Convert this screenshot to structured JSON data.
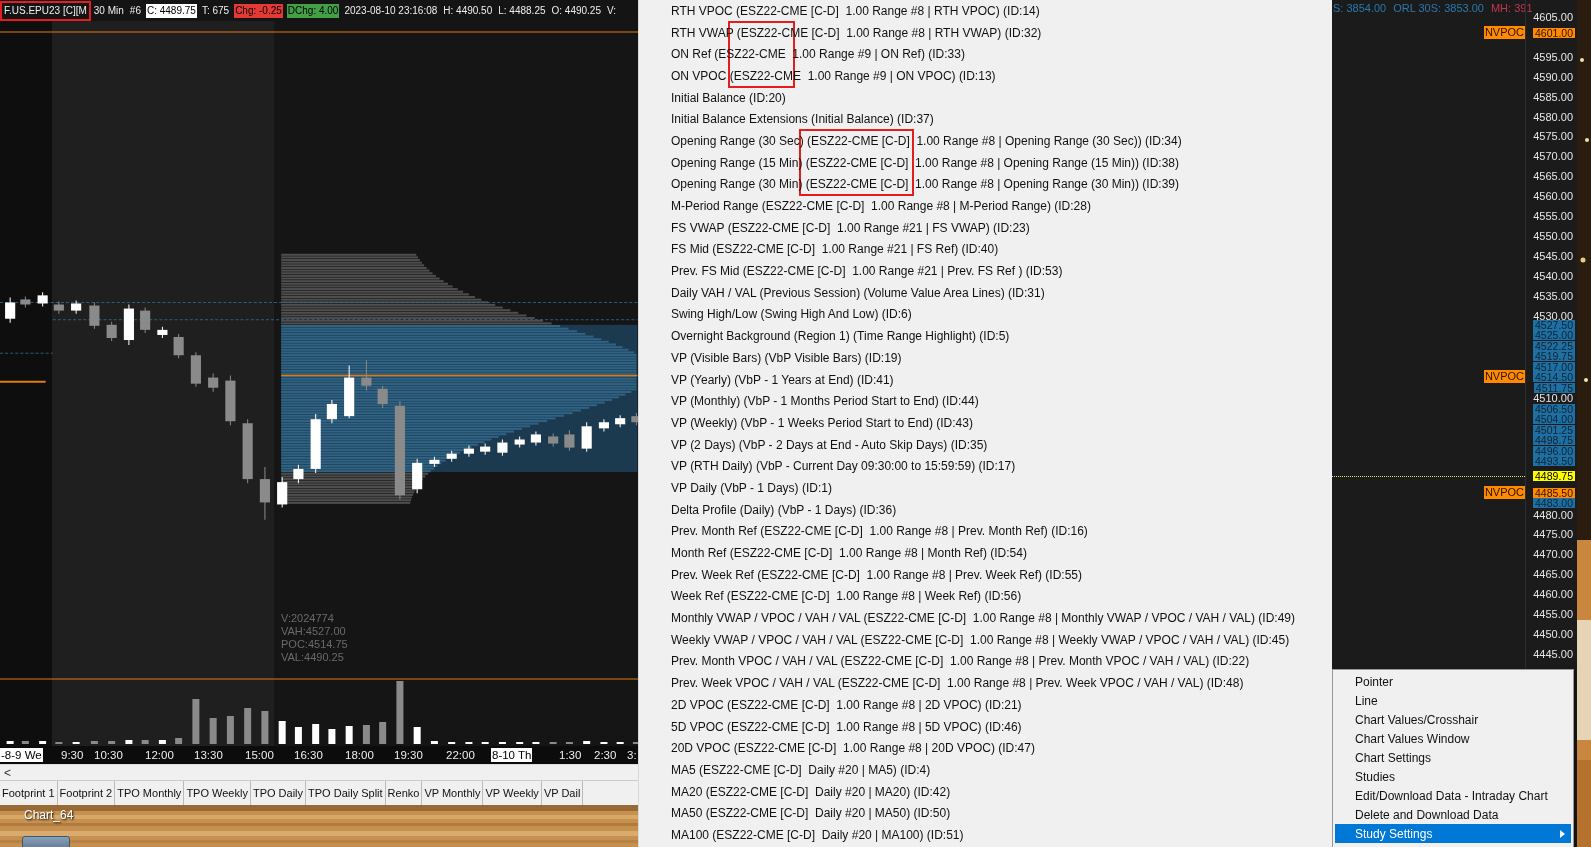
{
  "chart": {
    "header": [
      {
        "text": "F.US.EPU23 [C][M",
        "kind": "symbol",
        "boxed": true
      },
      {
        "text": "30 Min",
        "kind": "plain",
        "boxed": false
      },
      {
        "text": "#6",
        "kind": "plain",
        "boxed": false
      },
      {
        "text": "C: 4489.75",
        "kind": "close",
        "boxed": false
      },
      {
        "text": "T: 675",
        "kind": "plain",
        "boxed": false
      },
      {
        "text": "Chg: -0.25",
        "kind": "down",
        "boxed": false
      },
      {
        "text": "DChg: 4.00",
        "kind": "up",
        "boxed": false
      },
      {
        "text": "2023-08-10 23:16:08",
        "kind": "plain",
        "boxed": false
      },
      {
        "text": "H: 4490.50",
        "kind": "plain",
        "boxed": false
      },
      {
        "text": "L: 4488.25",
        "kind": "plain",
        "boxed": false
      },
      {
        "text": "O: 4490.25",
        "kind": "plain",
        "boxed": false
      },
      {
        "text": "V:",
        "kind": "plain",
        "boxed": false
      }
    ],
    "profile_stats": [
      "V:2024774",
      "VAH:4527.00",
      "POC:4514.75",
      "VAL:4490.25"
    ],
    "time_axis": [
      {
        "text": "-8-9 We",
        "highlighted": true
      },
      {
        "text": "9:30",
        "highlighted": false
      },
      {
        "text": "10:30",
        "highlighted": false
      },
      {
        "text": "12:00",
        "highlighted": false
      },
      {
        "text": "13:30",
        "highlighted": false
      },
      {
        "text": "15:00",
        "highlighted": false
      },
      {
        "text": "16:30",
        "highlighted": false
      },
      {
        "text": "18:00",
        "highlighted": false
      },
      {
        "text": "19:30",
        "highlighted": false
      },
      {
        "text": "22:00",
        "highlighted": false
      },
      {
        "text": "8-10 Th",
        "highlighted": true
      },
      {
        "text": "1:30",
        "highlighted": false
      },
      {
        "text": "2:30",
        "highlighted": false
      },
      {
        "text": "3:",
        "highlighted": false
      }
    ],
    "scroll_left": "<",
    "tabs": [
      {
        "label": "Footprint 1",
        "selected": false
      },
      {
        "label": "Footprint 2",
        "selected": false
      },
      {
        "label": "TPO Monthly",
        "selected": false
      },
      {
        "label": "TPO Weekly",
        "selected": false
      },
      {
        "label": "TPO Daily",
        "selected": false
      },
      {
        "label": "TPO Daily Split",
        "selected": false
      },
      {
        "label": "Renko",
        "selected": false
      },
      {
        "label": "VP Monthly",
        "selected": false
      },
      {
        "label": "VP Weekly",
        "selected": false
      },
      {
        "label": "VP Dail",
        "selected": false
      }
    ]
  },
  "studies": [
    {
      "text": "RTH VPOC (ESZ22-CME [C-D]  1.00 Range #8 | RTH VPOC) (ID:14)",
      "boxed": false
    },
    {
      "text": "RTH VWAP (ESZ22-CME [C-D]  1.00 Range #8 | RTH VWAP) (ID:32)",
      "boxed": true
    },
    {
      "text": "ON Ref (ESZ22-CME  1.00 Range #9 | ON Ref) (ID:33)",
      "boxed": true
    },
    {
      "text": "ON VPOC (ESZ22-CME  1.00 Range #9 | ON VPOC) (ID:13)",
      "boxed": true
    },
    {
      "text": "Initial Balance (ID:20)",
      "boxed": false
    },
    {
      "text": "Initial Balance Extensions (Initial Balance) (ID:37)",
      "boxed": false
    },
    {
      "text": "Opening Range (30 Sec) (ESZ22-CME [C-D]  1.00 Range #8 | Opening Range (30 Sec)) (ID:34)",
      "boxed": true
    },
    {
      "text": "Opening Range (15 Min) (ESZ22-CME [C-D]  1.00 Range #8 | Opening Range (15 Min)) (ID:38)",
      "boxed": true
    },
    {
      "text": "Opening Range (30 Min) (ESZ22-CME [C-D]  1.00 Range #8 | Opening Range (30 Min)) (ID:39)",
      "boxed": true
    },
    {
      "text": "M-Period Range (ESZ22-CME [C-D]  1.00 Range #8 | M-Period Range) (ID:28)",
      "boxed": false
    },
    {
      "text": "FS VWAP (ESZ22-CME [C-D]  1.00 Range #21 | FS VWAP) (ID:23)",
      "boxed": false
    },
    {
      "text": "FS Mid (ESZ22-CME [C-D]  1.00 Range #21 | FS Ref) (ID:40)",
      "boxed": false
    },
    {
      "text": "Prev. FS Mid (ESZ22-CME [C-D]  1.00 Range #21 | Prev. FS Ref ) (ID:53)",
      "boxed": false
    },
    {
      "text": "Daily VAH / VAL (Previous Session) (Volume Value Area Lines) (ID:31)",
      "boxed": false
    },
    {
      "text": "Swing High/Low (Swing High And Low) (ID:6)",
      "boxed": false
    },
    {
      "text": "Overnight Background (Region 1) (Time Range Highlight) (ID:5)",
      "boxed": false
    },
    {
      "text": "VP (Visible Bars) (VbP Visible Bars) (ID:19)",
      "boxed": false
    },
    {
      "text": "VP (Yearly) (VbP - 1 Years at End) (ID:41)",
      "boxed": false
    },
    {
      "text": "VP (Monthly) (VbP - 1 Months Period Start to End) (ID:44)",
      "boxed": false
    },
    {
      "text": "VP (Weekly) (VbP - 1 Weeks Period Start to End) (ID:43)",
      "boxed": false
    },
    {
      "text": "VP (2 Days) (VbP - 2 Days at End - Auto Skip Days) (ID:35)",
      "boxed": false
    },
    {
      "text": "VP (RTH Daily) (VbP - Current Day 09:30:00 to 15:59:59) (ID:17)",
      "boxed": false
    },
    {
      "text": "VP Daily (VbP - 1 Days) (ID:1)",
      "boxed": false
    },
    {
      "text": "Delta Profile (Daily) (VbP - 1 Days) (ID:36)",
      "boxed": false
    },
    {
      "text": "Prev. Month Ref (ESZ22-CME [C-D]  1.00 Range #8 | Prev. Month Ref) (ID:16)",
      "boxed": false
    },
    {
      "text": "Month Ref (ESZ22-CME [C-D]  1.00 Range #8 | Month Ref) (ID:54)",
      "boxed": false
    },
    {
      "text": "Prev. Week Ref (ESZ22-CME [C-D]  1.00 Range #8 | Prev. Week Ref) (ID:55)",
      "boxed": false
    },
    {
      "text": "Week Ref (ESZ22-CME [C-D]  1.00 Range #8 | Week Ref) (ID:56)",
      "boxed": false
    },
    {
      "text": "Monthly VWAP / VPOC / VAH / VAL (ESZ22-CME [C-D]  1.00 Range #8 | Monthly VWAP / VPOC / VAH / VAL) (ID:49)",
      "boxed": false
    },
    {
      "text": "Weekly VWAP / VPOC / VAH / VAL (ESZ22-CME [C-D]  1.00 Range #8 | Weekly VWAP / VPOC / VAH / VAL) (ID:45)",
      "boxed": false
    },
    {
      "text": "Prev. Month VPOC / VAH / VAL (ESZ22-CME [C-D]  1.00 Range #8 | Prev. Month VPOC / VAH / VAL) (ID:22)",
      "boxed": false
    },
    {
      "text": "Prev. Week VPOC / VAH / VAL (ESZ22-CME [C-D]  1.00 Range #8 | Prev. Week VPOC / VAH / VAL) (ID:48)",
      "boxed": false
    },
    {
      "text": "2D VPOC (ESZ22-CME [C-D]  1.00 Range #8 | 2D VPOC) (ID:21)",
      "boxed": false
    },
    {
      "text": "5D VPOC (ESZ22-CME [C-D]  1.00 Range #8 | 5D VPOC) (ID:46)",
      "boxed": false
    },
    {
      "text": "20D VPOC (ESZ22-CME [C-D]  1.00 Range #8 | 20D VPOC) (ID:47)",
      "boxed": false
    },
    {
      "text": "MA5 (ESZ22-CME [C-D]  Daily #20 | MA5) (ID:4)",
      "boxed": false
    },
    {
      "text": "MA20 (ESZ22-CME [C-D]  Daily #20 | MA20) (ID:42)",
      "boxed": false
    },
    {
      "text": "MA50 (ESZ22-CME [C-D]  Daily #20 | MA50) (ID:50)",
      "boxed": false
    },
    {
      "text": "MA100 (ESZ22-CME [C-D]  Daily #20 | MA100) (ID:51)",
      "boxed": false
    }
  ],
  "price_chart": {
    "header": [
      {
        "text": "S: 3854.00",
        "color": "#2a78ad"
      },
      {
        "text": "ORL 30S: 3853.00",
        "color": "#2a78ad"
      },
      {
        "text": "MH: 391",
        "color": "#c43450"
      }
    ],
    "ticks": [
      "4605.00",
      "4595.00",
      "4590.00",
      "4585.00",
      "4580.00",
      "4575.00",
      "4570.00",
      "4565.00",
      "4560.00",
      "4555.00",
      "4550.00",
      "4545.00",
      "4540.00",
      "4535.00",
      "4530.00",
      "4510.00",
      "4480.00",
      "4475.00",
      "4470.00",
      "4465.00",
      "4460.00",
      "4455.00",
      "4450.00",
      "4445.00"
    ],
    "markers": [
      {
        "text": "4601.00",
        "kind": "nvpoc",
        "tag": "NVPOC"
      },
      {
        "text": "4527.50",
        "kind": "va"
      },
      {
        "text": "4525.00",
        "kind": "va"
      },
      {
        "text": "4522.25",
        "kind": "va"
      },
      {
        "text": "4519.75",
        "kind": "va"
      },
      {
        "text": "4517.00",
        "kind": "va"
      },
      {
        "text": "4514.50",
        "kind": "va",
        "tag": "NVPOC"
      },
      {
        "text": "4511.75",
        "kind": "va"
      },
      {
        "text": "4506.50",
        "kind": "va"
      },
      {
        "text": "4504.00",
        "kind": "va"
      },
      {
        "text": "4501.25",
        "kind": "va"
      },
      {
        "text": "4498.75",
        "kind": "va"
      },
      {
        "text": "4496.00",
        "kind": "va"
      },
      {
        "text": "4493.50",
        "kind": "va"
      },
      {
        "text": "4489.75",
        "kind": "last"
      },
      {
        "text": "4485.50",
        "kind": "nvpoc",
        "tag": "NVPOC"
      },
      {
        "text": "4483.00",
        "kind": "va"
      }
    ]
  },
  "context_menu": [
    {
      "label": "Pointer",
      "selected": false,
      "submenu": false
    },
    {
      "label": "Line",
      "selected": false,
      "submenu": false
    },
    {
      "label": "Chart Values/Crosshair",
      "selected": false,
      "submenu": false
    },
    {
      "label": "Chart Values Window",
      "selected": false,
      "submenu": false
    },
    {
      "label": "Chart Settings",
      "selected": false,
      "submenu": false
    },
    {
      "label": "Studies",
      "selected": false,
      "submenu": false
    },
    {
      "label": "Edit/Download Data - Intraday Chart",
      "selected": false,
      "submenu": false
    },
    {
      "label": "Delete and Download Data",
      "selected": false,
      "submenu": false
    },
    {
      "label": "Study Settings",
      "selected": true,
      "submenu": true
    }
  ],
  "desktop": {
    "label": "Chart_64"
  }
}
